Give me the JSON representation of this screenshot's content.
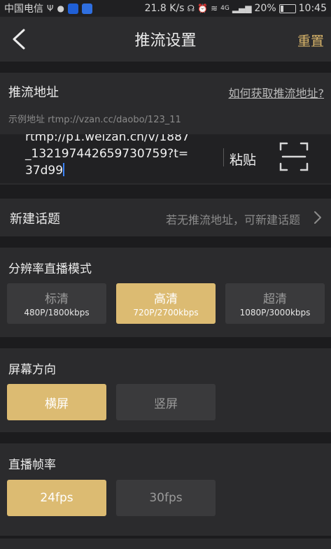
{
  "status_bar": {
    "carrier": "中国电信",
    "speed": "21.8 K/s",
    "network": "4G",
    "battery": "20%",
    "battery_level": 0.2,
    "time": "10:45",
    "app_icon_colors": [
      "#1f5fd6",
      "#2f6fe0"
    ]
  },
  "nav": {
    "title": "推流设置",
    "reset_label": "重置"
  },
  "push_url": {
    "label": "推流地址",
    "help_link": "如何获取推流地址?",
    "example": "示例地址 rtmp://vzan.cc/daobo/123_11",
    "value": "rtmp://p1.weizan.cn/v/1887\n_132197442659730759?t=\n37d99",
    "paste_label": "粘贴",
    "scan_icon": "scan-icon"
  },
  "new_topic": {
    "label": "新建话题",
    "hint": "若无推流地址，可新建话题"
  },
  "resolution": {
    "title": "分辨率直播模式",
    "options": [
      {
        "name": "标清",
        "detail": "480P/1800kbps",
        "selected": false
      },
      {
        "name": "高清",
        "detail": "720P/2700kbps",
        "selected": true
      },
      {
        "name": "超清",
        "detail": "1080P/3000kbps",
        "selected": false
      }
    ]
  },
  "orientation": {
    "title": "屏幕方向",
    "options": [
      {
        "name": "横屏",
        "selected": true
      },
      {
        "name": "竖屏",
        "selected": false
      }
    ]
  },
  "frame_rate": {
    "title": "直播帧率",
    "options": [
      {
        "name": "24fps",
        "selected": true
      },
      {
        "name": "30fps",
        "selected": false
      }
    ]
  },
  "colors": {
    "accent": "#dcbb72",
    "reset": "#d9b56a"
  }
}
